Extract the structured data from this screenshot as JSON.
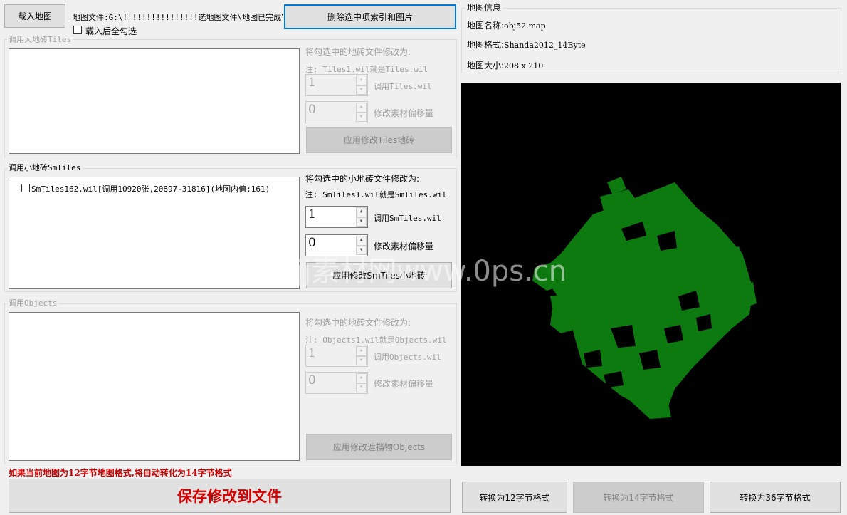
{
  "top": {
    "load_map_label": "载入地图",
    "map_file_text": "地图文件:G:\\!!!!!!!!!!!!!!!!选地图文件\\地图已完成\\",
    "select_all_label": "载入后全勾选",
    "delete_selected_label": "删除选中项索引和图片"
  },
  "tiles_group": {
    "title": "调用大地砖Tiles",
    "modify_label": "将勾选中的地砖文件修改为:",
    "note": "注: Tiles1.wil就是Tiles.wil",
    "file_index_value": "1",
    "file_index_label": "调用Tiles.wil",
    "offset_value": "0",
    "offset_label": "修改素材偏移量",
    "apply_label": "应用修改Tiles地砖"
  },
  "smtiles_group": {
    "title": "调用小地砖SmTiles",
    "items": [
      {
        "label": "SmTiles162.wil[调用10920张,20897-31816](地图内值:161)"
      }
    ],
    "modify_label": "将勾选中的小地砖文件修改为:",
    "note": "注: SmTiles1.wil就是SmTiles.wil",
    "file_index_value": "1",
    "file_index_label": "调用SmTiles.wil",
    "offset_value": "0",
    "offset_label": "修改素材偏移量",
    "apply_label": "应用修改SmTiles小地砖"
  },
  "objects_group": {
    "title": "调用Objects",
    "modify_label": "将勾选中的地砖文件修改为:",
    "note": "注: Objects1.wil就是Objects.wil",
    "file_index_value": "1",
    "file_index_label": "调用Objects.wil",
    "offset_value": "0",
    "offset_label": "修改素材偏移量",
    "apply_label": "应用修改遮挡物Objects"
  },
  "warning_text": "如果当前地图为12字节地图格式,将自动转化为14字节格式",
  "save_label": "保存修改到文件",
  "map_info": {
    "title": "地图信息",
    "name_label": "地图名称:",
    "name_value": "obj52.map",
    "format_label": "地图格式:",
    "format_value": "Shanda2012_14Byte",
    "size_label": "地图大小:",
    "size_value": "208 x 210"
  },
  "watermark": "jj素材网www.0ps.cn",
  "convert": {
    "to12_label": "转换为12字节格式",
    "to14_label": "转换为14字节格式",
    "to36_label": "转换为36字节格式"
  },
  "colors": {
    "map_background": "#000000",
    "map_fill": "#0d7a10",
    "warning": "#cc0000",
    "save_text": "#d40000",
    "focus_border": "#0078d7"
  }
}
